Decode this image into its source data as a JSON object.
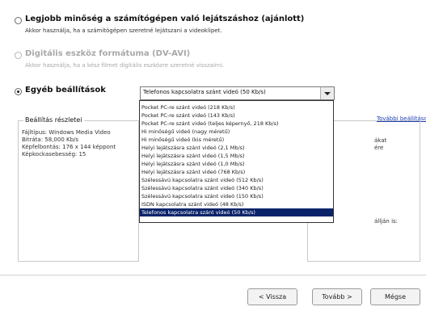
{
  "options": [
    {
      "title": "Legjobb minőség a számítógépen való lejátszáshoz (ajánlott)",
      "description": "Akkor használja, ha a számítógépen szeretné lejátszani a videoklipet.",
      "checked": false,
      "enabled": true
    },
    {
      "title": "Digitális eszköz formátuma (DV-AVI)",
      "description": "Akkor használja, ha a kész filmet digitális eszközre szeretné visszaírni.",
      "checked": false,
      "enabled": false
    },
    {
      "title": "Egyéb beállítások",
      "description": "",
      "checked": true,
      "enabled": true
    }
  ],
  "settings_combo": {
    "value": "Telefonos kapcsolatra szánt videó (50 Kb/s)"
  },
  "dropdown_items": [
    "Pocket PC-re szánt videó (218 Kb/s)",
    "Pocket PC-re szánt videó (143 Kb/s)",
    "Pocket PC-re szánt videó (teljes képernyő, 218 Kb/s)",
    "Hi minőségű videó (nagy méretű)",
    "Hi minőségű videó (kis méretű)",
    "Helyi lejátszásra szánt videó (2,1 Mb/s)",
    "Helyi lejátszásra szánt videó (1,5 Mb/s)",
    "Helyi lejátszásra szánt videó (1,0 Mb/s)",
    "Helyi lejátszásra szánt videó (768 Kb/s)",
    "Szélessávú kapcsolatra szánt videó (512 Kb/s)",
    "Szélessávú kapcsolatra szánt videó (340 Kb/s)",
    "Szélessávú kapcsolatra szánt videó (150 Kb/s)",
    "ISDN kapcsolatra szánt videó (48 Kb/s)",
    "Telefonos kapcsolatra szánt videó (50 Kb/s)"
  ],
  "selected_index": 13,
  "details": {
    "legend": "Beállítás részletei",
    "lines": [
      "Fájltípus: Windows Media Video",
      "Bitráta: 58,000 Kb/s",
      "Képfelbontás: 176 x 144 képpont",
      "Képkockasebesség: 15"
    ],
    "right_lines": [
      "ákat",
      "ére"
    ],
    "right_tail": "állján is:"
  },
  "more_link": "További beállítások...",
  "buttons": {
    "back": "< Vissza",
    "next": "Tovább >",
    "cancel": "Mégse"
  }
}
